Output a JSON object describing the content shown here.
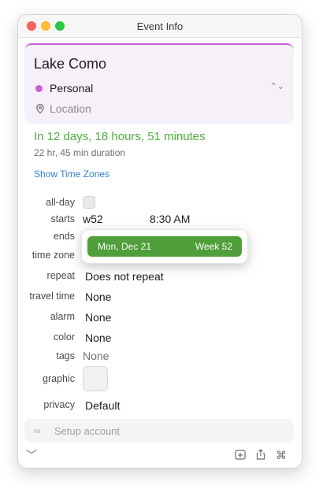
{
  "window": {
    "title": "Event Info"
  },
  "event": {
    "title": "Lake Como",
    "calendar": "Personal",
    "calendar_color": "#c95ed8",
    "location_placeholder": "Location"
  },
  "summary": {
    "countdown": "In 12 days, 18 hours, 51 minutes",
    "duration": "22 hr, 45 min duration",
    "show_time_zones": "Show Time Zones"
  },
  "fields": {
    "all_day_label": "all-day",
    "starts_label": "starts",
    "starts_date": "w52",
    "starts_time": "8:30 AM",
    "ends_label": "ends",
    "time_zone_label": "time zone",
    "repeat_label": "repeat",
    "repeat_value": "Does not repeat",
    "travel_label": "travel time",
    "travel_value": "None",
    "alarm_label": "alarm",
    "alarm_value": "None",
    "color_label": "color",
    "color_value": "None",
    "tags_label": "tags",
    "tags_value": "None",
    "graphic_label": "graphic",
    "privacy_label": "privacy",
    "privacy_value": "Default"
  },
  "date_popup": {
    "date": "Mon, Dec 21",
    "week": "Week 52",
    "color": "#4f9f3a"
  },
  "footer": {
    "setup_text": "Setup account",
    "icons": [
      "collapse-icon",
      "add-calendar-icon",
      "share-icon",
      "command-icon"
    ]
  }
}
